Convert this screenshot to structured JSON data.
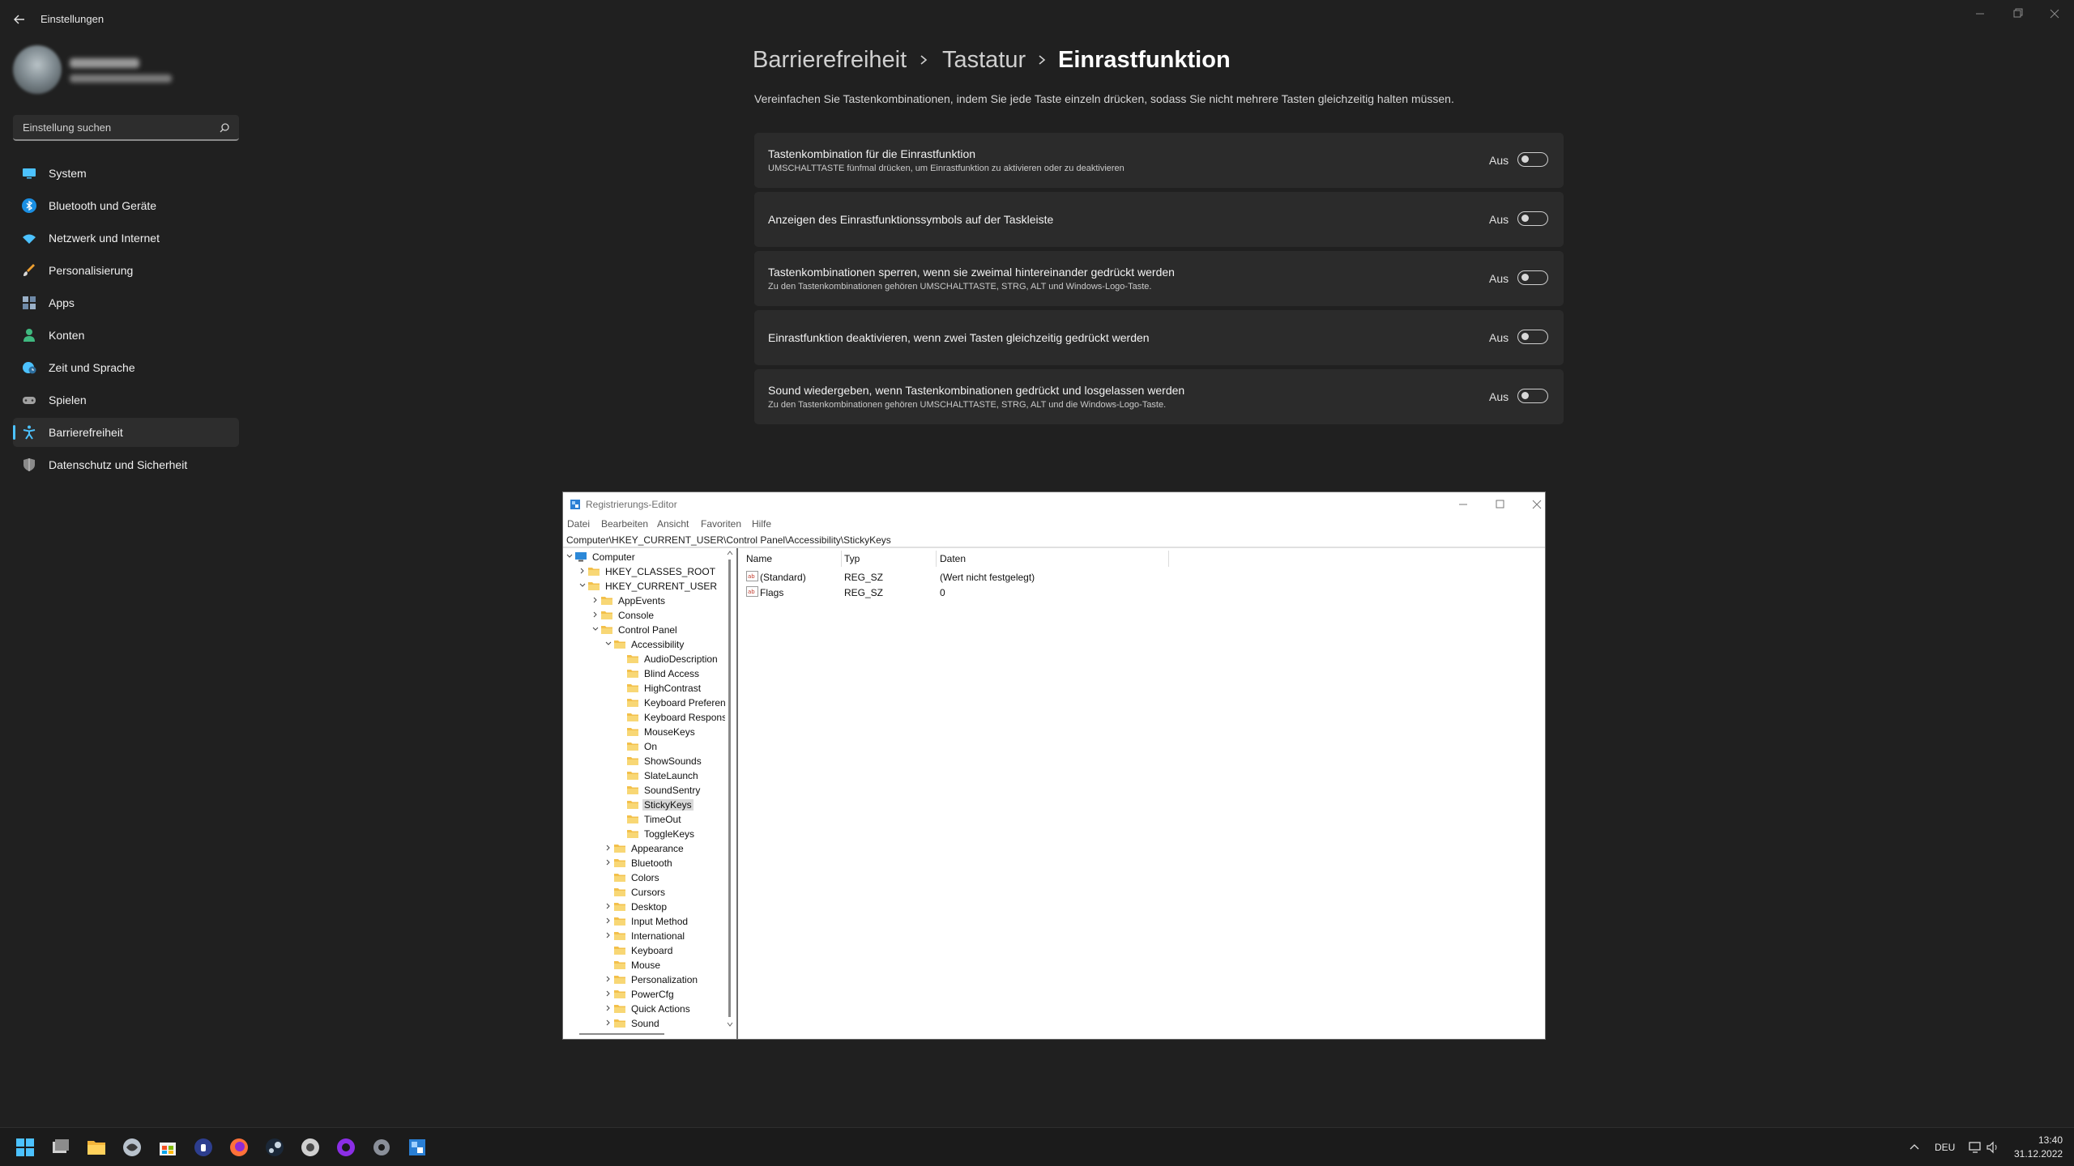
{
  "app": {
    "title": "Einstellungen"
  },
  "search": {
    "placeholder": "Einstellung suchen"
  },
  "nav": [
    {
      "label": "System",
      "icon": "monitor-icon",
      "color": "#4cc2ff"
    },
    {
      "label": "Bluetooth und Geräte",
      "icon": "bluetooth-icon",
      "color": "#1a8fe3"
    },
    {
      "label": "Netzwerk und Internet",
      "icon": "wifi-icon",
      "color": "#4cc2ff"
    },
    {
      "label": "Personalisierung",
      "icon": "brush-icon",
      "color": "#f0a030"
    },
    {
      "label": "Apps",
      "icon": "apps-icon",
      "color": "#9ab0c8"
    },
    {
      "label": "Konten",
      "icon": "person-icon",
      "color": "#3fb87f"
    },
    {
      "label": "Zeit und Sprache",
      "icon": "globe-clock-icon",
      "color": "#4cc2ff"
    },
    {
      "label": "Spielen",
      "icon": "gamepad-icon",
      "color": "#a0a0a0"
    },
    {
      "label": "Barrierefreiheit",
      "icon": "accessibility-icon",
      "color": "#4cc2ff",
      "active": true
    },
    {
      "label": "Datenschutz und Sicherheit",
      "icon": "shield-icon",
      "color": "#8a8a8a"
    }
  ],
  "breadcrumb": [
    "Barrierefreiheit",
    "Tastatur",
    "Einrastfunktion"
  ],
  "description": "Vereinfachen Sie Tastenkombinationen, indem Sie jede Taste einzeln drücken, sodass Sie nicht mehrere Tasten gleichzeitig halten müssen.",
  "settings": [
    {
      "title": "Tastenkombination für die Einrastfunktion",
      "subtitle": "UMSCHALTTASTE fünfmal drücken, um Einrastfunktion zu aktivieren oder zu deaktivieren",
      "state": "Aus"
    },
    {
      "title": "Anzeigen des Einrastfunktionssymbols auf der Taskleiste",
      "subtitle": "",
      "state": "Aus"
    },
    {
      "title": "Tastenkombinationen sperren, wenn sie zweimal hintereinander gedrückt werden",
      "subtitle": "Zu den Tastenkombinationen gehören UMSCHALTTASTE, STRG, ALT und Windows-Logo-Taste.",
      "state": "Aus"
    },
    {
      "title": "Einrastfunktion deaktivieren, wenn zwei Tasten gleichzeitig gedrückt werden",
      "subtitle": "",
      "state": "Aus"
    },
    {
      "title": "Sound wiedergeben, wenn Tastenkombinationen gedrückt und losgelassen werden",
      "subtitle": "Zu den Tastenkombinationen gehören UMSCHALTTASTE, STRG, ALT und die Windows-Logo-Taste.",
      "state": "Aus"
    }
  ],
  "regedit": {
    "title": "Registrierungs-Editor",
    "menu": [
      "Datei",
      "Bearbeiten",
      "Ansicht",
      "Favoriten",
      "Hilfe"
    ],
    "address": "Computer\\HKEY_CURRENT_USER\\Control Panel\\Accessibility\\StickyKeys",
    "tree": [
      {
        "label": "Computer",
        "depth": 0,
        "chev": "down",
        "kind": "computer"
      },
      {
        "label": "HKEY_CLASSES_ROOT",
        "depth": 1,
        "chev": "right"
      },
      {
        "label": "HKEY_CURRENT_USER",
        "depth": 1,
        "chev": "down"
      },
      {
        "label": "AppEvents",
        "depth": 2,
        "chev": "right"
      },
      {
        "label": "Console",
        "depth": 2,
        "chev": "right"
      },
      {
        "label": "Control Panel",
        "depth": 2,
        "chev": "down"
      },
      {
        "label": "Accessibility",
        "depth": 3,
        "chev": "down"
      },
      {
        "label": "AudioDescription",
        "depth": 4,
        "chev": ""
      },
      {
        "label": "Blind Access",
        "depth": 4,
        "chev": ""
      },
      {
        "label": "HighContrast",
        "depth": 4,
        "chev": ""
      },
      {
        "label": "Keyboard Preferen",
        "depth": 4,
        "chev": ""
      },
      {
        "label": "Keyboard Respons",
        "depth": 4,
        "chev": ""
      },
      {
        "label": "MouseKeys",
        "depth": 4,
        "chev": ""
      },
      {
        "label": "On",
        "depth": 4,
        "chev": ""
      },
      {
        "label": "ShowSounds",
        "depth": 4,
        "chev": ""
      },
      {
        "label": "SlateLaunch",
        "depth": 4,
        "chev": ""
      },
      {
        "label": "SoundSentry",
        "depth": 4,
        "chev": ""
      },
      {
        "label": "StickyKeys",
        "depth": 4,
        "chev": "",
        "selected": true
      },
      {
        "label": "TimeOut",
        "depth": 4,
        "chev": ""
      },
      {
        "label": "ToggleKeys",
        "depth": 4,
        "chev": ""
      },
      {
        "label": "Appearance",
        "depth": 3,
        "chev": "right"
      },
      {
        "label": "Bluetooth",
        "depth": 3,
        "chev": "right"
      },
      {
        "label": "Colors",
        "depth": 3,
        "chev": ""
      },
      {
        "label": "Cursors",
        "depth": 3,
        "chev": ""
      },
      {
        "label": "Desktop",
        "depth": 3,
        "chev": "right"
      },
      {
        "label": "Input Method",
        "depth": 3,
        "chev": "right"
      },
      {
        "label": "International",
        "depth": 3,
        "chev": "right"
      },
      {
        "label": "Keyboard",
        "depth": 3,
        "chev": ""
      },
      {
        "label": "Mouse",
        "depth": 3,
        "chev": ""
      },
      {
        "label": "Personalization",
        "depth": 3,
        "chev": "right"
      },
      {
        "label": "PowerCfg",
        "depth": 3,
        "chev": "right"
      },
      {
        "label": "Quick Actions",
        "depth": 3,
        "chev": "right"
      },
      {
        "label": "Sound",
        "depth": 3,
        "chev": "right"
      }
    ],
    "columns": [
      "Name",
      "Typ",
      "Daten"
    ],
    "values": [
      {
        "name": "(Standard)",
        "type": "REG_SZ",
        "data": "(Wert nicht festgelegt)"
      },
      {
        "name": "Flags",
        "type": "REG_SZ",
        "data": "0"
      }
    ]
  },
  "taskbar": {
    "apps": [
      "windows-start-icon",
      "task-view-icon",
      "file-explorer-icon",
      "browser-icon",
      "store-icon",
      "password-manager-icon",
      "firefox-icon",
      "steam-icon",
      "chrome-icon",
      "media-icon",
      "settings-icon",
      "regedit-icon"
    ],
    "language": "DEU",
    "time": "13:40",
    "date": "31.12.2022"
  }
}
